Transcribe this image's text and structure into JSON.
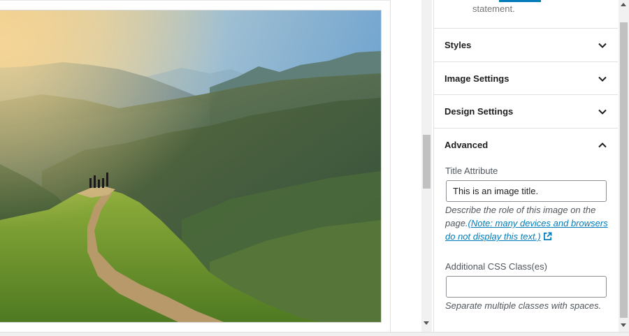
{
  "sidebar": {
    "clipped_text": "statement.",
    "panels": {
      "styles": {
        "label": "Styles"
      },
      "image_settings": {
        "label": "Image Settings"
      },
      "design_settings": {
        "label": "Design Settings"
      },
      "advanced": {
        "label": "Advanced"
      }
    },
    "advanced": {
      "title_attribute": {
        "label": "Title Attribute",
        "value": "This is an image title.",
        "help_text": "Describe the role of this image on the page.",
        "help_link": "(Note: many devices and browsers do not display this text.)"
      },
      "css_class": {
        "label": "Additional CSS Class(es)",
        "value": "",
        "help_text": "Separate multiple classes with spaces."
      }
    }
  },
  "icons": {
    "collapsed": "chevron-down-icon",
    "expanded": "chevron-up-icon",
    "external": "external-link-icon"
  },
  "colors": {
    "accent": "#007cba",
    "border": "#e0e0e0",
    "help_text": "#50575e"
  }
}
